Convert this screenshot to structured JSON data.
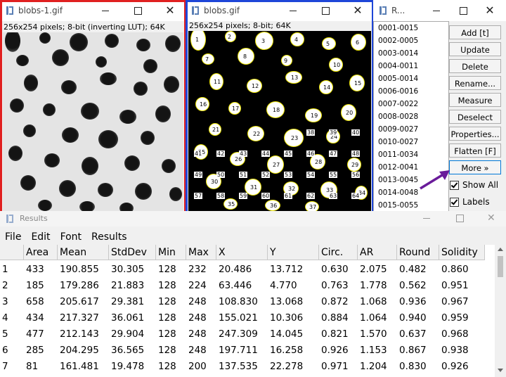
{
  "colors": {
    "gray_selection": "#e02020",
    "binary_selection": "#1e46d8",
    "outline": "#f0e800",
    "arrow": "#6a1b9a"
  },
  "window1": {
    "title": "blobs-1.gif",
    "info": "256x254 pixels; 8-bit (inverting LUT); 64K"
  },
  "window2": {
    "title": "blobs.gif",
    "info": "256x254 pixels; 8-bit; 64K",
    "labels": [
      "1",
      "2",
      "3",
      "4",
      "5",
      "6",
      "7",
      "8",
      "9",
      "10",
      "11",
      "12",
      "13",
      "14",
      "15",
      "16",
      "17",
      "18",
      "19",
      "20",
      "21",
      "22",
      "23",
      "24",
      "25",
      "26",
      "27",
      "28",
      "29",
      "30",
      "31",
      "32",
      "33",
      "34",
      "35",
      "36",
      "37",
      "38",
      "39",
      "40",
      "41",
      "42",
      "43",
      "44",
      "45",
      "46",
      "47",
      "48",
      "49",
      "50",
      "51",
      "52",
      "53",
      "54",
      "55",
      "56",
      "57",
      "58",
      "59",
      "60",
      "61",
      "62",
      "63",
      "64"
    ]
  },
  "roi_manager": {
    "title": "R...",
    "items": [
      "0001-0015",
      "0002-0005",
      "0003-0014",
      "0004-0011",
      "0005-0014",
      "0006-0016",
      "0007-0022",
      "0008-0028",
      "0009-0027",
      "0010-0027",
      "0011-0034",
      "0012-0041",
      "0013-0045",
      "0014-0048",
      "0015-0055"
    ],
    "buttons": [
      "Add [t]",
      "Update",
      "Delete",
      "Rename...",
      "Measure",
      "Deselect",
      "Properties...",
      "Flatten [F]",
      "More »"
    ],
    "checkboxes": [
      {
        "label": "Show All",
        "checked": true
      },
      {
        "label": "Labels",
        "checked": true
      }
    ]
  },
  "results": {
    "title": "Results",
    "menu": [
      "File",
      "Edit",
      "Font",
      "Results"
    ],
    "columns": [
      "",
      "Area",
      "Mean",
      "StdDev",
      "Min",
      "Max",
      "X",
      "Y",
      "Circ.",
      "AR",
      "Round",
      "Solidity"
    ],
    "rows": [
      [
        "1",
        "433",
        "190.855",
        "30.305",
        "128",
        "232",
        "20.486",
        "13.712",
        "0.630",
        "2.075",
        "0.482",
        "0.860"
      ],
      [
        "2",
        "185",
        "179.286",
        "21.883",
        "128",
        "224",
        "63.446",
        "4.770",
        "0.763",
        "1.778",
        "0.562",
        "0.951"
      ],
      [
        "3",
        "658",
        "205.617",
        "29.381",
        "128",
        "248",
        "108.830",
        "13.068",
        "0.872",
        "1.068",
        "0.936",
        "0.967"
      ],
      [
        "4",
        "434",
        "217.327",
        "36.061",
        "128",
        "248",
        "155.021",
        "10.306",
        "0.884",
        "1.064",
        "0.940",
        "0.959"
      ],
      [
        "5",
        "477",
        "212.143",
        "29.904",
        "128",
        "248",
        "247.309",
        "14.045",
        "0.821",
        "1.570",
        "0.637",
        "0.968"
      ],
      [
        "6",
        "285",
        "204.295",
        "36.565",
        "128",
        "248",
        "197.711",
        "16.258",
        "0.926",
        "1.153",
        "0.867",
        "0.938"
      ],
      [
        "7",
        "81",
        "161.481",
        "19.478",
        "128",
        "200",
        "137.535",
        "22.278",
        "0.971",
        "1.204",
        "0.830",
        "0.926"
      ]
    ]
  }
}
